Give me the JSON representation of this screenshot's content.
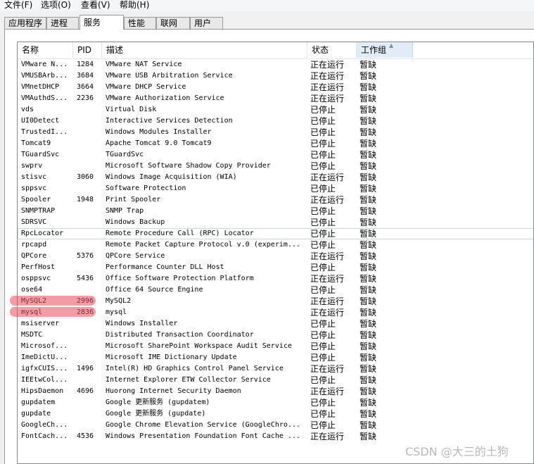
{
  "menubar": [
    "文件(F)",
    "选项(O)",
    "查看(V)",
    "帮助(H)"
  ],
  "tabs": [
    "应用程序",
    "进程",
    "服务",
    "性能",
    "联网",
    "用户"
  ],
  "active_tab": "服务",
  "columns": {
    "name": "名称",
    "pid": "PID",
    "desc": "描述",
    "status": "状态",
    "group": "工作组"
  },
  "rows": [
    {
      "name": "VMware N...",
      "pid": "1284",
      "desc": "VMware NAT Service",
      "status": "正在运行",
      "group": "暂缺"
    },
    {
      "name": "VMUSBArb...",
      "pid": "3684",
      "desc": "VMware USB Arbitration Service",
      "status": "正在运行",
      "group": "暂缺"
    },
    {
      "name": "VMnetDHCP",
      "pid": "3664",
      "desc": "VMware DHCP Service",
      "status": "正在运行",
      "group": "暂缺"
    },
    {
      "name": "VMAuthdS...",
      "pid": "2236",
      "desc": "VMware Authorization Service",
      "status": "正在运行",
      "group": "暂缺"
    },
    {
      "name": "vds",
      "pid": "",
      "desc": "Virtual Disk",
      "status": "已停止",
      "group": "暂缺"
    },
    {
      "name": "UI0Detect",
      "pid": "",
      "desc": "Interactive Services Detection",
      "status": "已停止",
      "group": "暂缺"
    },
    {
      "name": "TrustedI...",
      "pid": "",
      "desc": "Windows Modules Installer",
      "status": "已停止",
      "group": "暂缺"
    },
    {
      "name": "Tomcat9",
      "pid": "",
      "desc": "Apache Tomcat 9.0 Tomcat9",
      "status": "已停止",
      "group": "暂缺"
    },
    {
      "name": "TGuardSvc",
      "pid": "",
      "desc": "TGuardSvc",
      "status": "已停止",
      "group": "暂缺"
    },
    {
      "name": "swprv",
      "pid": "",
      "desc": "Microsoft Software Shadow Copy Provider",
      "status": "已停止",
      "group": "暂缺"
    },
    {
      "name": "stisvc",
      "pid": "3060",
      "desc": "Windows Image Acquisition (WIA)",
      "status": "正在运行",
      "group": "暂缺"
    },
    {
      "name": "sppsvc",
      "pid": "",
      "desc": "Software Protection",
      "status": "已停止",
      "group": "暂缺"
    },
    {
      "name": "Spooler",
      "pid": "1948",
      "desc": "Print Spooler",
      "status": "正在运行",
      "group": "暂缺"
    },
    {
      "name": "SNMPTRAP",
      "pid": "",
      "desc": "SNMP Trap",
      "status": "已停止",
      "group": "暂缺"
    },
    {
      "name": "SDRSVC",
      "pid": "",
      "desc": "Windows Backup",
      "status": "已停止",
      "group": "暂缺"
    },
    {
      "name": "RpcLocator",
      "pid": "",
      "desc": "Remote Procedure Call (RPC) Locator",
      "status": "已停止",
      "group": "暂缺",
      "focused": true
    },
    {
      "name": "rpcapd",
      "pid": "",
      "desc": "Remote Packet Capture Protocol v.0 (experim...",
      "status": "已停止",
      "group": "暂缺"
    },
    {
      "name": "QPCore",
      "pid": "5376",
      "desc": "QPCore Service",
      "status": "正在运行",
      "group": "暂缺"
    },
    {
      "name": "PerfHost",
      "pid": "",
      "desc": "Performance Counter DLL Host",
      "status": "已停止",
      "group": "暂缺"
    },
    {
      "name": "osppsvc",
      "pid": "5436",
      "desc": "Office Software Protection Platform",
      "status": "正在运行",
      "group": "暂缺"
    },
    {
      "name": "ose64",
      "pid": "",
      "desc": "Office 64 Source Engine",
      "status": "已停止",
      "group": "暂缺"
    },
    {
      "name": "MySQL2",
      "pid": "2996",
      "desc": "MySQL2",
      "status": "正在运行",
      "group": "暂缺",
      "marked": true
    },
    {
      "name": "mysql",
      "pid": "2836",
      "desc": "mysql",
      "status": "正在运行",
      "group": "暂缺",
      "marked": true
    },
    {
      "name": "msiserver",
      "pid": "",
      "desc": "Windows Installer",
      "status": "已停止",
      "group": "暂缺"
    },
    {
      "name": "MSDTC",
      "pid": "",
      "desc": "Distributed Transaction Coordinator",
      "status": "已停止",
      "group": "暂缺"
    },
    {
      "name": "Microsof...",
      "pid": "",
      "desc": "Microsoft SharePoint Workspace Audit Service",
      "status": "已停止",
      "group": "暂缺"
    },
    {
      "name": "ImeDictU...",
      "pid": "",
      "desc": "Microsoft IME Dictionary Update",
      "status": "已停止",
      "group": "暂缺"
    },
    {
      "name": "igfxCUIS...",
      "pid": "1496",
      "desc": "Intel(R) HD Graphics Control Panel Service",
      "status": "正在运行",
      "group": "暂缺"
    },
    {
      "name": "IEEtwCol...",
      "pid": "",
      "desc": "Internet Explorer ETW Collector Service",
      "status": "已停止",
      "group": "暂缺"
    },
    {
      "name": "HipsDaemon",
      "pid": "4696",
      "desc": "Huorong Internet Security Daemon",
      "status": "正在运行",
      "group": "暂缺"
    },
    {
      "name": "gupdatem",
      "pid": "",
      "desc": "Google 更新服务 (gupdatem)",
      "status": "已停止",
      "group": "暂缺"
    },
    {
      "name": "gupdate",
      "pid": "",
      "desc": "Google 更新服务 (gupdate)",
      "status": "已停止",
      "group": "暂缺"
    },
    {
      "name": "GoogleCh...",
      "pid": "",
      "desc": "Google Chrome Elevation Service (GoogleChro...",
      "status": "已停止",
      "group": "暂缺"
    },
    {
      "name": "FontCach...",
      "pid": "4536",
      "desc": "Windows Presentation Foundation Font Cache ...",
      "status": "正在运行",
      "group": "暂缺"
    }
  ],
  "watermark": "CSDN @大三的土狗",
  "colors": {
    "highlight_mark": "#e84a5a",
    "sorted_column": "#e1ecf7"
  }
}
